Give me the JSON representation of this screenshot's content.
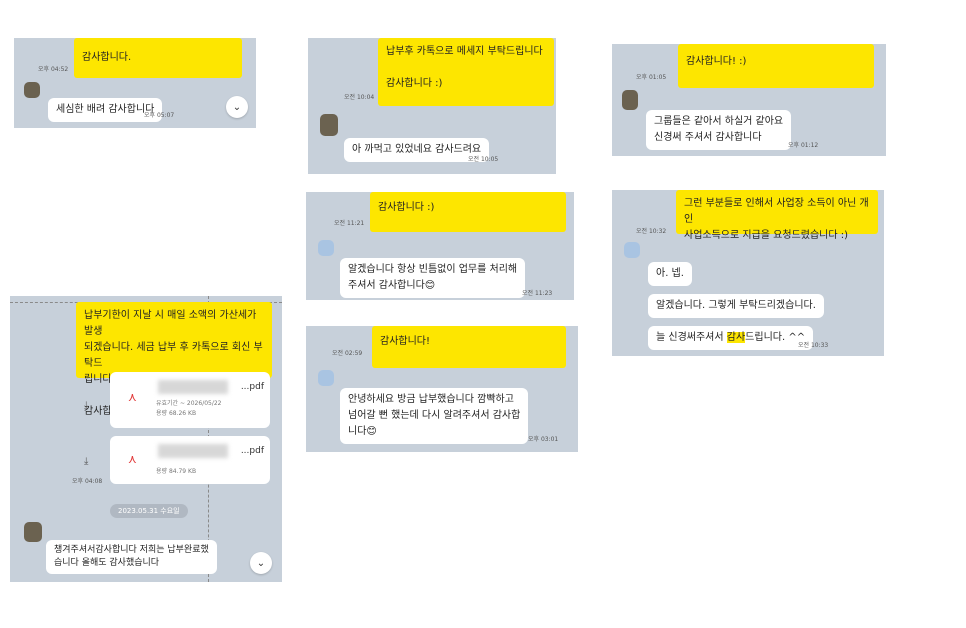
{
  "colors": {
    "panel_bg": "#c7d0da",
    "yellow_bubble": "#fde600",
    "white_bubble": "#ffffff"
  },
  "p1": {
    "time1": "오후 04:52",
    "yellow_text": "감사합니다.",
    "white_text": "세심한 배려 감사합니다",
    "time2": "오후 05:07",
    "fab_icon": "chevron-down-icon"
  },
  "p2": {
    "yellow_text": "납부후 카톡으로 메세지 부탁드립니다\n\n감사합니다 :)",
    "time1": "오전 10:04",
    "white_text": "아 까먹고 있었네요 감사드려요",
    "time2": "오전 10:05"
  },
  "p3": {
    "time1": "오후 01:05",
    "yellow_text": "감사합니다! :)",
    "white_text": "그룹들은 같아서 하실거 같아요\n신경써 주셔서 감사합니다",
    "time2": "오후 01:12"
  },
  "p4": {
    "time1": "오전 11:21",
    "yellow_text": "감사합니다 :)",
    "white_text": "알겠습니다 항상 빈틈없이 업무를 처리해\n주셔서 감사합니다😊",
    "time2": "오전 11:23"
  },
  "p5": {
    "time1": "오전 10:32",
    "yellow_text": "그런 부분들로 인해서 사업장 소득이 아닌 개인\n사업소득으로 지급을 요청드렸습니다 :)",
    "msg1": "아. 넵.",
    "msg2": "알겠습니다. 그렇게 부탁드리겠습니다.",
    "msg3_pre": "늘 신경써주셔서 ",
    "msg3_hl": "감사",
    "msg3_post": "드립니다. ^^",
    "time2": "오전 10:33"
  },
  "p6": {
    "time1": "오전 02:59",
    "yellow_text": "감사합니다!",
    "white_text": "안녕하세요 방금 납부했습니다 깜빡하고\n넘어갈 뻔 했는데 다시 알려주셔서 감사합\n니다😊",
    "time2": "오후 03:01"
  },
  "p7": {
    "yellow_text": "납부기한이 지날 시 매일 소액의 가산세가 발생\n되겠습니다. 세금 납부 후 카톡으로 회신 부탁드\n립니다.\n\n감사합니다.",
    "file1": {
      "ext": "...pdf",
      "meta1": "유효기간 ~ 2026/05/22",
      "meta2": "용량 68.26 KB"
    },
    "file2": {
      "ext": "...pdf",
      "meta2": "용량 84.79 KB"
    },
    "time1": "오후 04:08",
    "date": "2023.05.31 수요일",
    "white_text": "챙겨주셔서감사합니다 저희는 납부완료했\n습니다 올해도 감사했습니다",
    "fab_icon": "chevron-down-icon"
  }
}
